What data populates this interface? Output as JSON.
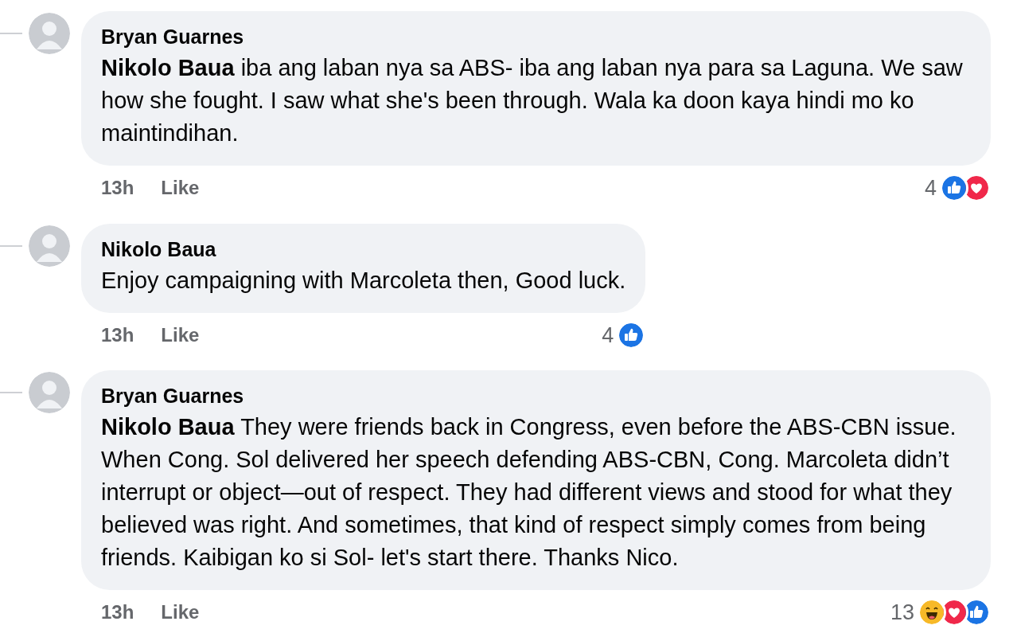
{
  "comments": [
    {
      "author": "Bryan Guarnes",
      "text": "**Nikolo Baua** iba ang laban nya sa ABS- iba ang laban nya para sa Laguna. We saw how she fought. I saw what she's been through. Wala ka doon kaya hindi mo ko maintindihan.",
      "time": "13h",
      "like_label": "Like",
      "reaction_count": "4",
      "reactions": [
        {
          "kind": "like"
        },
        {
          "kind": "love"
        }
      ]
    },
    {
      "author": "Nikolo Baua",
      "text": "Enjoy campaigning with Marcoleta then, Good luck.",
      "time": "13h",
      "like_label": "Like",
      "reaction_count": "4",
      "reactions": [
        {
          "kind": "like"
        }
      ]
    },
    {
      "author": "Bryan Guarnes",
      "text": "**Nikolo Baua** They were friends back in Congress, even before the ABS-CBN issue. When Cong. Sol delivered her speech defending ABS-CBN, Cong. Marcoleta didn’t interrupt or object—out of respect. They had different views and stood for what they believed was right. And sometimes, that kind of respect simply comes from being friends. Kaibigan ko si Sol- let's start there. Thanks Nico.",
      "time": "13h",
      "like_label": "Like",
      "reaction_count": "13",
      "reactions": [
        {
          "kind": "haha"
        },
        {
          "kind": "love"
        },
        {
          "kind": "like"
        }
      ]
    }
  ]
}
